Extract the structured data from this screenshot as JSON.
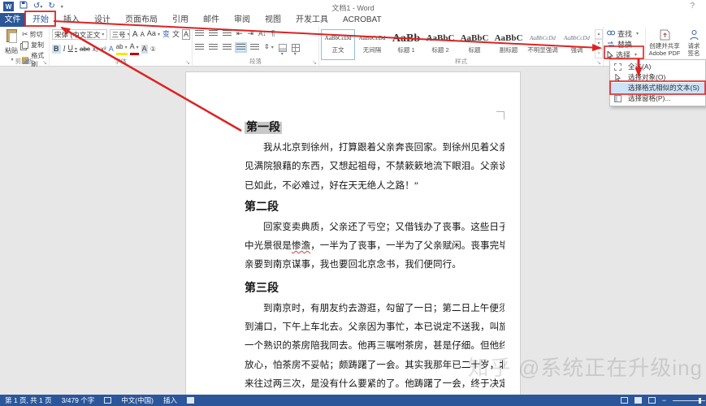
{
  "titlebar": {
    "title": "文档1 - Word",
    "help": "?"
  },
  "tabs": {
    "file": "文件",
    "items": [
      "开始",
      "插入",
      "设计",
      "页面布局",
      "引用",
      "邮件",
      "审阅",
      "视图",
      "开发工具",
      "ACROBAT"
    ],
    "active": "开始"
  },
  "ribbon": {
    "clipboard": {
      "paste": "粘贴",
      "cut": "剪切",
      "copy": "复制",
      "format_painter": "格式刷",
      "label": "剪贴板"
    },
    "font": {
      "name": "宋体 (中文正文",
      "size": "三号",
      "label": "字体"
    },
    "paragraph": {
      "label": "段落"
    },
    "styles": {
      "label": "样式",
      "items": [
        {
          "preview": "AaBbCcDd",
          "label": "正文"
        },
        {
          "preview": "AaBbCcDd",
          "label": "无间隔"
        },
        {
          "preview": "AaBb",
          "label": "标题 1"
        },
        {
          "preview": "AaBbC",
          "label": "标题 2"
        },
        {
          "preview": "AaBbC",
          "label": "标题"
        },
        {
          "preview": "AaBbC",
          "label": "副标题"
        },
        {
          "preview": "AaBbCcDd",
          "label": "不明显强调"
        },
        {
          "preview": "AaBbCcDd",
          "label": "强调"
        }
      ]
    },
    "editing": {
      "find": "查找",
      "replace": "替换",
      "select": "选择"
    },
    "adobe": {
      "pdf_line1": "创建并共享",
      "pdf_line2": "Adobe PDF",
      "sign_line1": "请求",
      "sign_line2": "签名"
    }
  },
  "select_menu": {
    "items": [
      "全选(A)",
      "选择对象(O)",
      "选择格式相似的文本(S)",
      "选择窗格(P)..."
    ],
    "highlighted": "选择格式相似的文本(S)"
  },
  "document": {
    "heading1": "第一段",
    "p1l1": "我从北京到徐州，打算跟着父亲奔丧回家。到徐州见着父亲，看",
    "p1l2": "见满院狼藉的东西，又想起祖母，不禁簌簌地流下眼泪。父亲说：“事",
    "p1l3": "已如此，不必难过，好在天无绝人之路！”",
    "heading2": "第二段",
    "p2l1": "回家变卖典质，父亲还了亏空；又借钱办了丧事。这些日子，家",
    "p2l2a": "中光景很是",
    "p2l2b": "惨澹",
    "p2l2c": "，一半为了丧事，一半为了父亲赋闲。丧事完毕，父",
    "p2l3": "亲要到南京谋事，我也要回北京念书，我们便同行。",
    "heading3": "第三段",
    "p3l1": "到南京时，有朋友约去游逛，勾留了一日；第二日上午便须渡江",
    "p3l2": "到浦口，下午上车北去。父亲因为事忙，本已说定不送我，叫旅馆里",
    "p3l3": "一个熟识的茶房陪我同去。他再三嘱咐茶房，甚是仔细。但他终于不",
    "p3l4": "放心，怕茶房不妥帖；颇踌躇了一会。其实我那年已二十岁，北京已",
    "p3l5": "来往过两三次，是没有什么要紧的了。他踌躇了一会，终于决定还是"
  },
  "watermark": "知乎 @系统正在升级ing",
  "statusbar": {
    "page_info": "第 1 页, 共 1 页",
    "word_count": "3/479 个字",
    "language": "中文(中国)",
    "insert_mode": "插入"
  },
  "colors": {
    "accent": "#2b579a",
    "annotation_red": "#dd2222",
    "selection_gray": "#c8c8c8",
    "doc_background": "#e7e7e7",
    "menu_highlight": "#cde3f7"
  }
}
